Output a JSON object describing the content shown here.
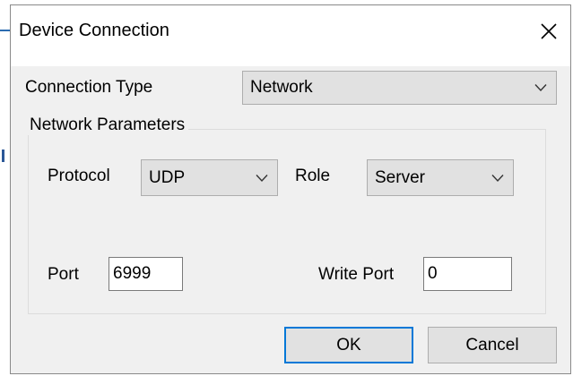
{
  "dialog": {
    "title": "Device Connection",
    "close_icon": "close-icon"
  },
  "connection_type": {
    "label": "Connection Type",
    "value": "Network"
  },
  "network_parameters": {
    "group_label": "Network Parameters",
    "protocol": {
      "label": "Protocol",
      "value": "UDP"
    },
    "role": {
      "label": "Role",
      "value": "Server"
    },
    "port": {
      "label": "Port",
      "value": "6999"
    },
    "write_port": {
      "label": "Write Port",
      "value": "0"
    }
  },
  "buttons": {
    "ok_label": "OK",
    "cancel_label": "Cancel"
  },
  "colors": {
    "default_button_border": "#0078d7",
    "dialog_background": "#f0f0f0",
    "title_background": "#ffffff"
  }
}
